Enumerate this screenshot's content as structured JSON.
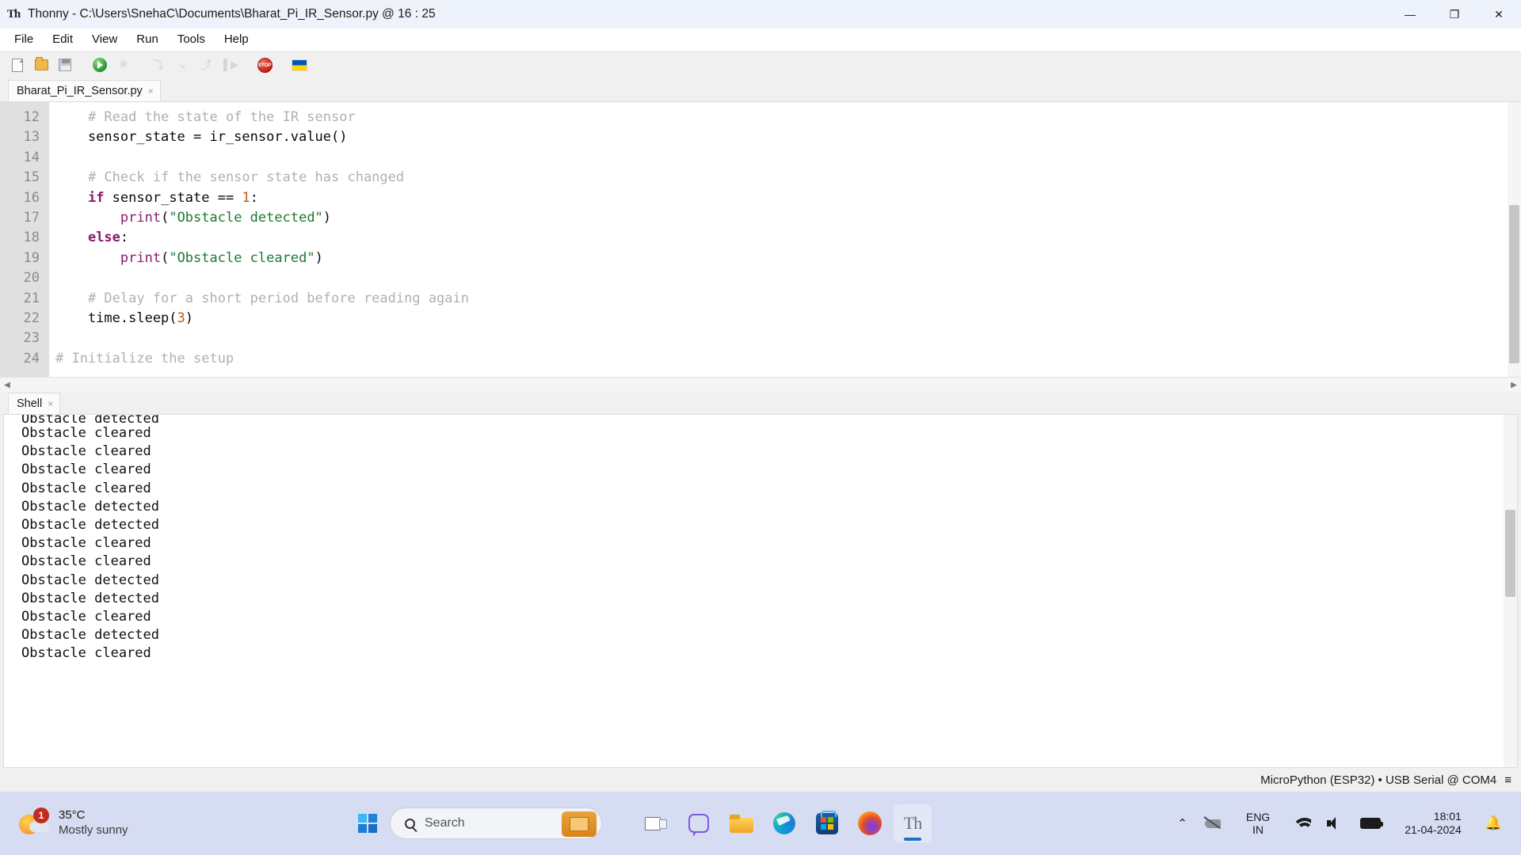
{
  "window": {
    "app_icon": "thonny-icon",
    "title": "Thonny  -  C:\\Users\\SnehaC\\Documents\\Bharat_Pi_IR_Sensor.py  @  16 : 25",
    "minimize": "—",
    "maximize": "❐",
    "close": "✕"
  },
  "menu": {
    "items": [
      {
        "label": "File"
      },
      {
        "label": "Edit"
      },
      {
        "label": "View"
      },
      {
        "label": "Run"
      },
      {
        "label": "Tools"
      },
      {
        "label": "Help"
      }
    ]
  },
  "toolbar": {
    "buttons": [
      {
        "name": "new-file-icon",
        "tooltip": "New"
      },
      {
        "name": "open-file-icon",
        "tooltip": "Load"
      },
      {
        "name": "save-file-icon",
        "tooltip": "Save"
      },
      {
        "name": "run-icon",
        "tooltip": "Run current script"
      },
      {
        "name": "debug-icon",
        "tooltip": "Debug current script"
      },
      {
        "name": "step-over-icon",
        "tooltip": "Step over"
      },
      {
        "name": "step-into-icon",
        "tooltip": "Step into"
      },
      {
        "name": "step-out-icon",
        "tooltip": "Step out"
      },
      {
        "name": "resume-icon",
        "tooltip": "Resume"
      },
      {
        "name": "stop-icon",
        "tooltip": "Stop/Restart backend"
      },
      {
        "name": "ukraine-flag-icon",
        "tooltip": "Support Ukraine"
      }
    ],
    "stop_label": "STOP"
  },
  "editor": {
    "tab": {
      "label": "Bharat_Pi_IR_Sensor.py",
      "close": "×"
    },
    "line_numbers": [
      "12",
      "13",
      "14",
      "15",
      "16",
      "17",
      "18",
      "19",
      "20",
      "21",
      "22",
      "23",
      "24"
    ],
    "lines": [
      {
        "n": 12,
        "tokens": [
          {
            "t": "    ",
            "c": "plain"
          },
          {
            "t": "# Read the state of the IR sensor",
            "c": "comment"
          }
        ]
      },
      {
        "n": 13,
        "tokens": [
          {
            "t": "    sensor_state = ir_sensor.value()",
            "c": "plain"
          }
        ]
      },
      {
        "n": 14,
        "tokens": [
          {
            "t": "",
            "c": "plain"
          }
        ]
      },
      {
        "n": 15,
        "tokens": [
          {
            "t": "    ",
            "c": "plain"
          },
          {
            "t": "# Check if the sensor state has changed",
            "c": "comment"
          }
        ]
      },
      {
        "n": 16,
        "tokens": [
          {
            "t": "    ",
            "c": "plain"
          },
          {
            "t": "if",
            "c": "kw"
          },
          {
            "t": " sensor_state == ",
            "c": "plain"
          },
          {
            "t": "1",
            "c": "num"
          },
          {
            "t": ":",
            "c": "plain"
          }
        ]
      },
      {
        "n": 17,
        "tokens": [
          {
            "t": "        ",
            "c": "plain"
          },
          {
            "t": "print",
            "c": "fn"
          },
          {
            "t": "(",
            "c": "plain"
          },
          {
            "t": "\"Obstacle detected\"",
            "c": "str"
          },
          {
            "t": ")",
            "c": "plain"
          }
        ]
      },
      {
        "n": 18,
        "tokens": [
          {
            "t": "    ",
            "c": "plain"
          },
          {
            "t": "else",
            "c": "kw"
          },
          {
            "t": ":",
            "c": "plain"
          }
        ]
      },
      {
        "n": 19,
        "tokens": [
          {
            "t": "        ",
            "c": "plain"
          },
          {
            "t": "print",
            "c": "fn"
          },
          {
            "t": "(",
            "c": "plain"
          },
          {
            "t": "\"Obstacle cleared\"",
            "c": "str"
          },
          {
            "t": ")",
            "c": "plain"
          }
        ]
      },
      {
        "n": 20,
        "tokens": [
          {
            "t": "",
            "c": "plain"
          }
        ]
      },
      {
        "n": 21,
        "tokens": [
          {
            "t": "    ",
            "c": "plain"
          },
          {
            "t": "# Delay for a short period before reading again",
            "c": "comment"
          }
        ]
      },
      {
        "n": 22,
        "tokens": [
          {
            "t": "    time.sleep(",
            "c": "plain"
          },
          {
            "t": "3",
            "c": "num"
          },
          {
            "t": ")",
            "c": "plain"
          }
        ]
      },
      {
        "n": 23,
        "tokens": [
          {
            "t": "",
            "c": "plain"
          }
        ]
      },
      {
        "n": 24,
        "tokens": [
          {
            "t": "# Initialize the setup",
            "c": "comment"
          }
        ]
      }
    ],
    "hscroll_left_arrow": "◀",
    "hscroll_right_arrow": "▶"
  },
  "shell": {
    "tab": {
      "label": "Shell",
      "close": "×"
    },
    "lines": [
      "Obstacle detected",
      "Obstacle cleared",
      "Obstacle cleared",
      "Obstacle cleared",
      "Obstacle cleared",
      "Obstacle detected",
      "Obstacle detected",
      "Obstacle cleared",
      "Obstacle cleared",
      "Obstacle detected",
      "Obstacle detected",
      "Obstacle cleared",
      "Obstacle detected",
      "Obstacle cleared"
    ]
  },
  "statusbar": {
    "interpreter": "MicroPython (ESP32)  •  USB Serial @ COM4",
    "menu_glyph": "≡"
  },
  "taskbar": {
    "weather": {
      "temperature": "35°C",
      "condition": "Mostly sunny",
      "badge": "1"
    },
    "start": {
      "name": "start-button"
    },
    "search": {
      "placeholder": "Search"
    },
    "apps": [
      {
        "name": "task-view-icon",
        "label": "Task View"
      },
      {
        "name": "chat-icon",
        "label": "Chat"
      },
      {
        "name": "file-explorer-icon",
        "label": "File Explorer"
      },
      {
        "name": "edge-icon",
        "label": "Microsoft Edge"
      },
      {
        "name": "microsoft-store-icon",
        "label": "Microsoft Store"
      },
      {
        "name": "firefox-icon",
        "label": "Firefox"
      },
      {
        "name": "thonny-taskbar-icon",
        "label": "Thonny"
      }
    ],
    "thonny_glyph": "Th",
    "tray": {
      "chevron": "⌃",
      "language_line1": "ENG",
      "language_line2": "IN",
      "time": "18:01",
      "date": "21-04-2024",
      "bell": "🔔"
    }
  },
  "colors": {
    "accent": "#1f6fd0",
    "comment": "#b0b0b0",
    "keyword": "#8b1a6b",
    "string": "#1b7a2e",
    "number": "#c25a12",
    "taskbar_bg": "#d6dcf2",
    "titlebar_bg": "#eef2fa"
  }
}
